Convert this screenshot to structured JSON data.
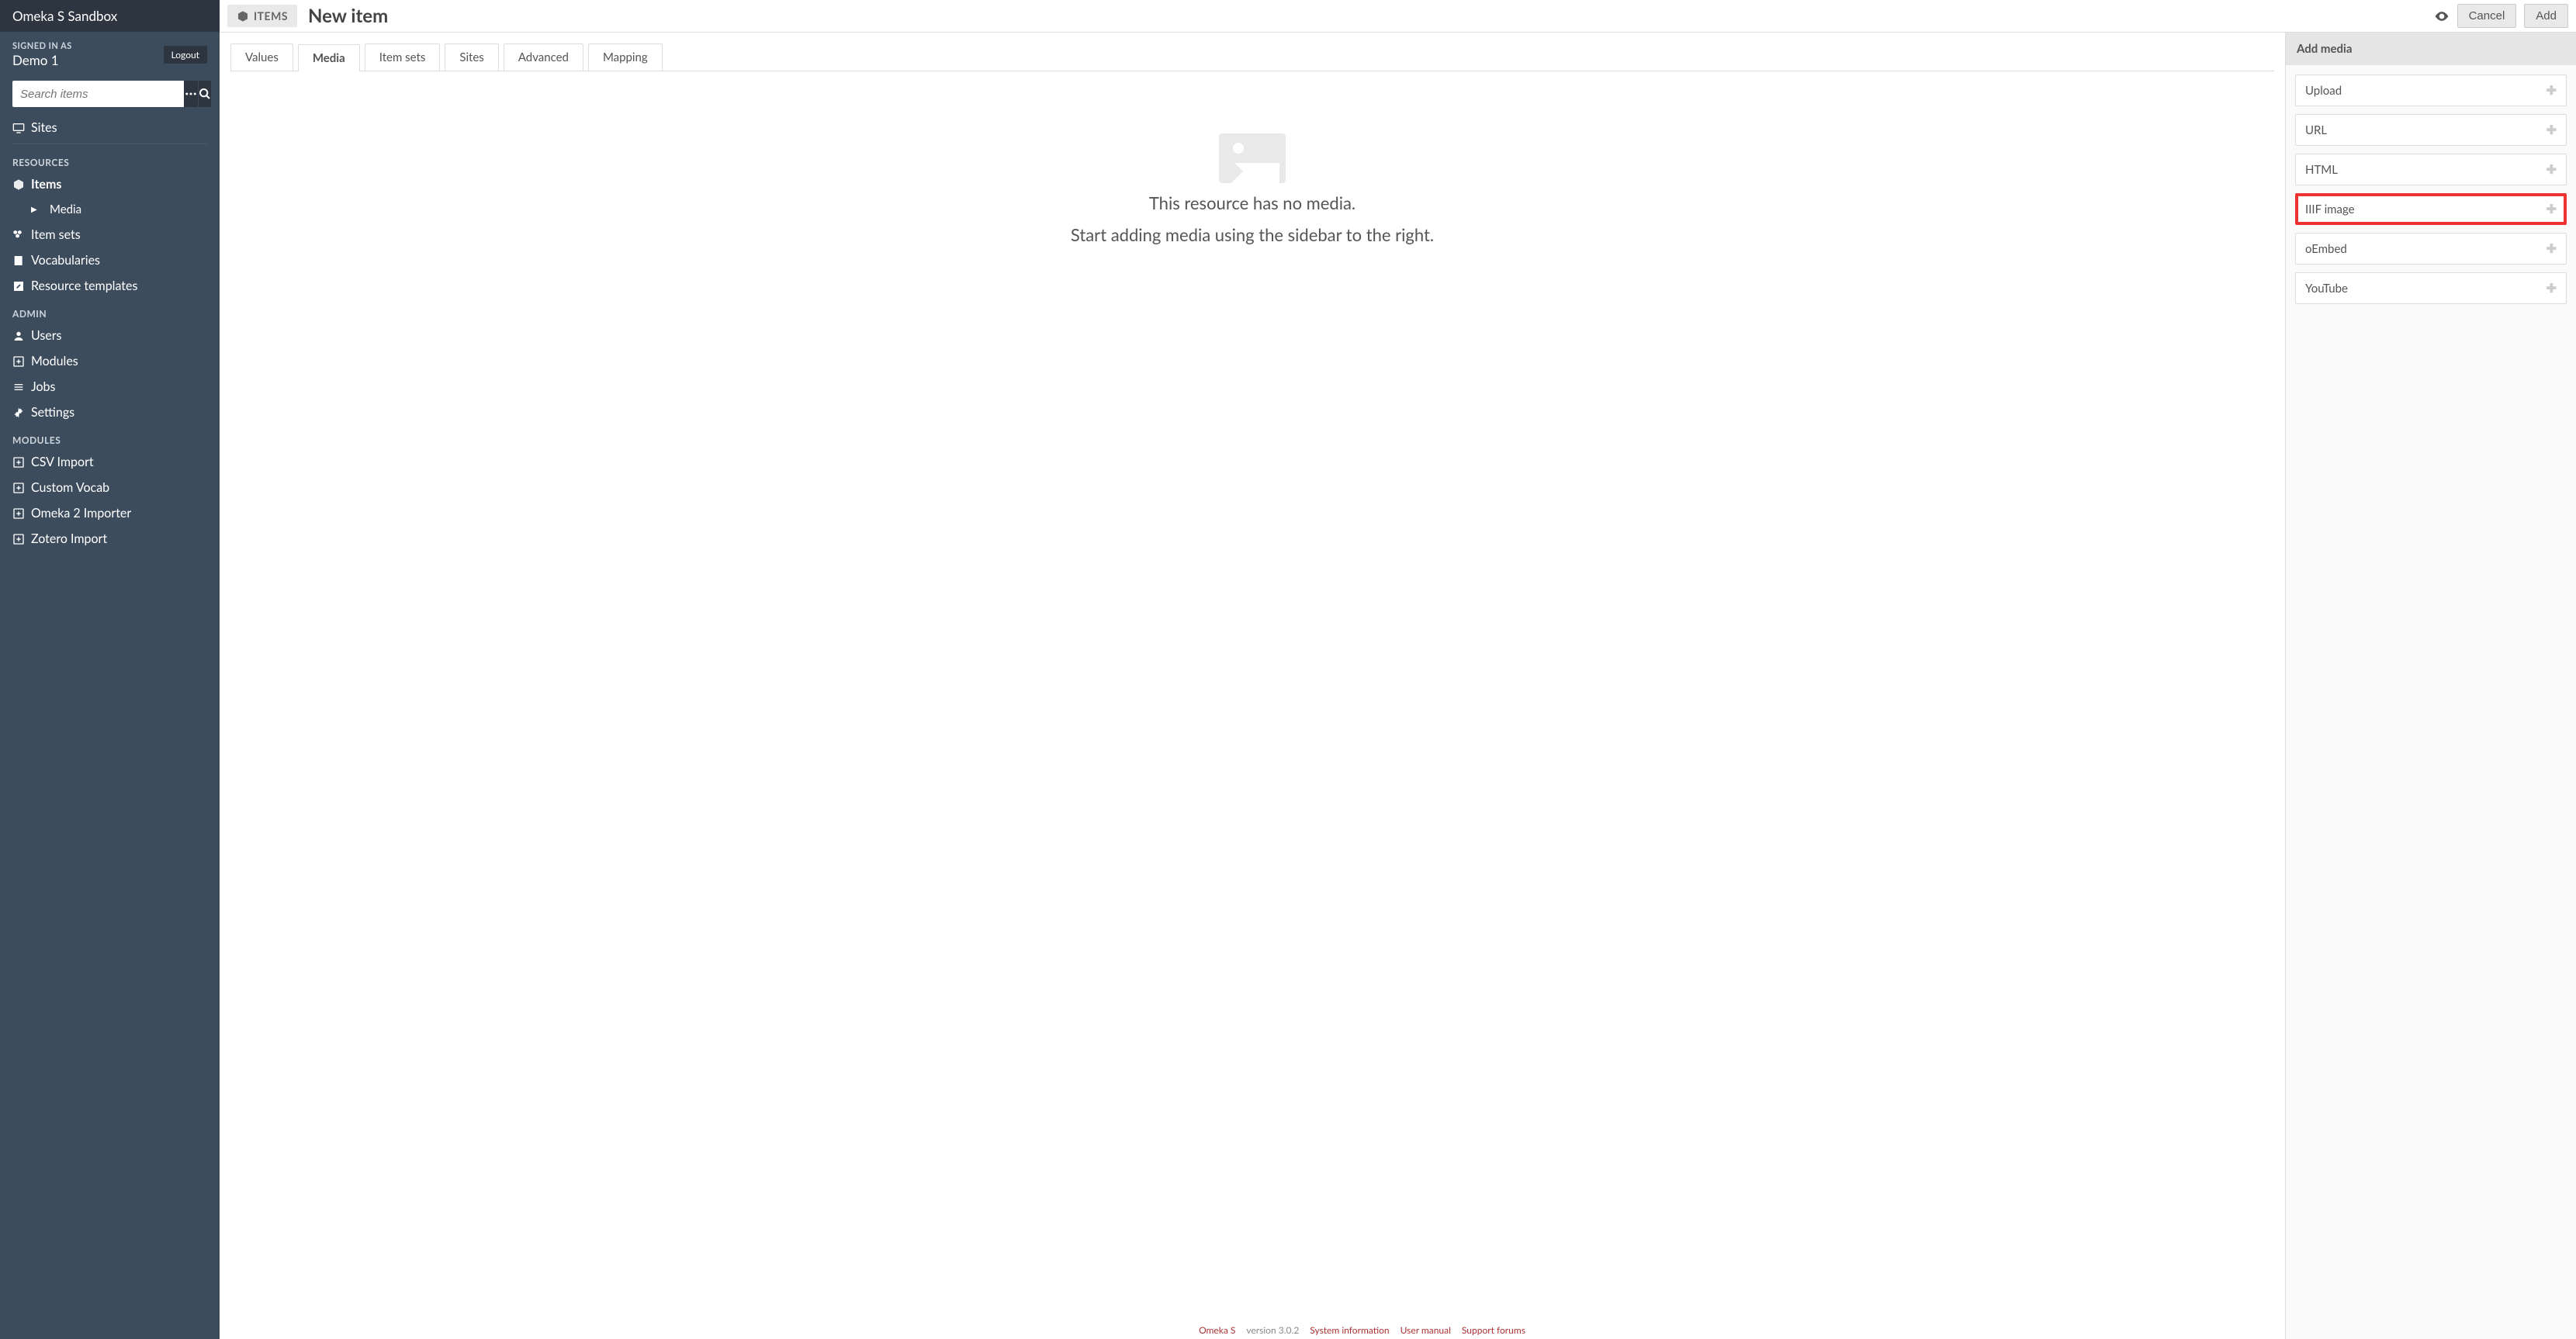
{
  "site_title": "Omeka S Sandbox",
  "user": {
    "signed_in_label": "SIGNED IN AS",
    "name": "Demo 1",
    "logout": "Logout"
  },
  "search": {
    "placeholder": "Search items"
  },
  "nav": {
    "sites": "Sites",
    "resources_header": "RESOURCES",
    "items": "Items",
    "media": "Media",
    "item_sets": "Item sets",
    "vocabularies": "Vocabularies",
    "resource_templates": "Resource templates",
    "admin_header": "ADMIN",
    "users": "Users",
    "modules": "Modules",
    "jobs": "Jobs",
    "settings": "Settings",
    "modules_header": "MODULES",
    "csv_import": "CSV Import",
    "custom_vocab": "Custom Vocab",
    "omeka2_importer": "Omeka 2 Importer",
    "zotero_import": "Zotero Import"
  },
  "breadcrumb": "ITEMS",
  "page_title": "New item",
  "actions": {
    "cancel": "Cancel",
    "add": "Add"
  },
  "tabs": {
    "values": "Values",
    "media": "Media",
    "item_sets": "Item sets",
    "sites": "Sites",
    "advanced": "Advanced",
    "mapping": "Mapping"
  },
  "empty": {
    "title": "This resource has no media.",
    "subtitle": "Start adding media using the sidebar to the right."
  },
  "panel": {
    "header": "Add media",
    "upload": "Upload",
    "url": "URL",
    "html": "HTML",
    "iiif": "IIIF image",
    "oembed": "oEmbed",
    "youtube": "YouTube"
  },
  "footer": {
    "omeka": "Omeka S",
    "version": "version 3.0.2",
    "sysinfo": "System information",
    "manual": "User manual",
    "forums": "Support forums"
  }
}
